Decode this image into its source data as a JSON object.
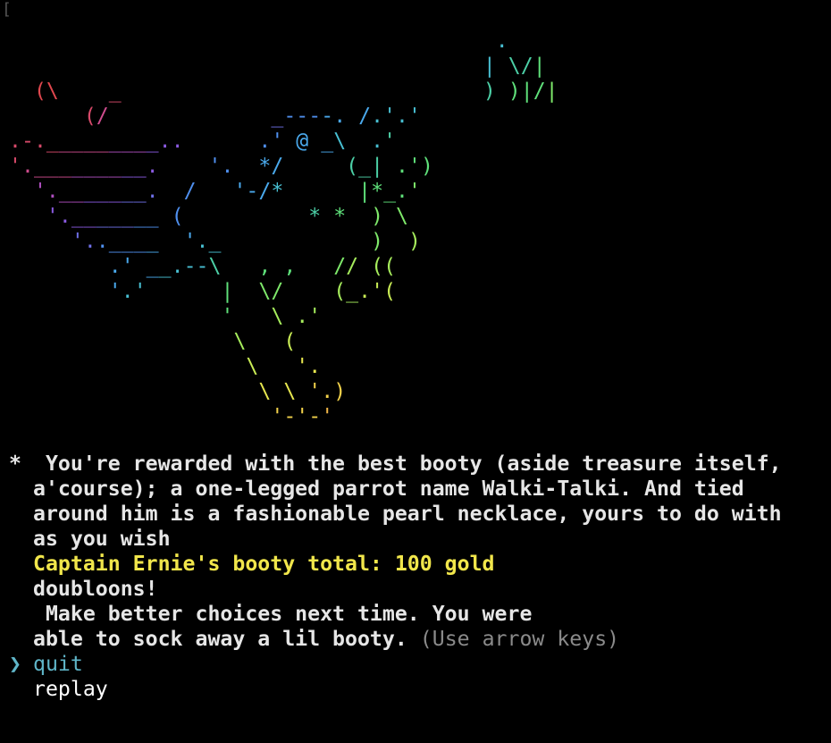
{
  "terminal": {
    "corner_glyph": "[",
    "ascii_art": {
      "colors": [
        "#e0413f",
        "#e4473c",
        "#e0474e",
        "#d84a6a",
        "#cf4c8e",
        "#b04fc0",
        "#8a5ae0",
        "#6e6fe6",
        "#4f8fee",
        "#4aa9ec",
        "#48bfd2",
        "#4ccfa6",
        "#5fe07a",
        "#7ee86a",
        "#a6ec5c",
        "#c9ec55",
        "#e6e64f",
        "#f2d24b",
        "#f2b648",
        "#f1a046",
        "#ef8a44",
        "#ec7a42",
        "#e86a40"
      ],
      "lines": [
        "                                       .",
        "                                      | \\/|",
        "  (\\    _                             ) )|/|",
        "      (/             _----. /.'.'",
        ".-._________..      .' @ _\\  .'",
        "'._________.    '.  */     (_| .')",
        "  '._______.  /   '-/*      |*_.'",
        "   '._______ (          * *  ) \\",
        "     '..____  '._            )  )",
        "        .' __.--\\   , ,   // ((",
        "        '.'      |  \\/    (_.'(",
        "                 '   \\ .'",
        "                  \\   (",
        "                   \\   '.",
        "                    \\ \\ '.)",
        "                     '-'-'"
      ]
    },
    "message": {
      "bullet": "*",
      "lines": [
        " You're rewarded with the best booty (aside treasure itself,",
        "a'course); a one-legged parrot name Walki-Talki. And tied",
        "around him is a fashionable pearl necklace, yours to do with",
        "as you wish"
      ],
      "gold_line": "Captain Ernie's booty total: 100 gold",
      "after_lines": [
        "doubloons!",
        " Make better choices next time. You were"
      ],
      "last_line": "able to sock away a lil booty.",
      "hint": " (Use arrow keys)"
    },
    "prompt": {
      "pointer": "❯",
      "options": [
        "quit",
        "replay"
      ],
      "selected_index": 0
    }
  }
}
